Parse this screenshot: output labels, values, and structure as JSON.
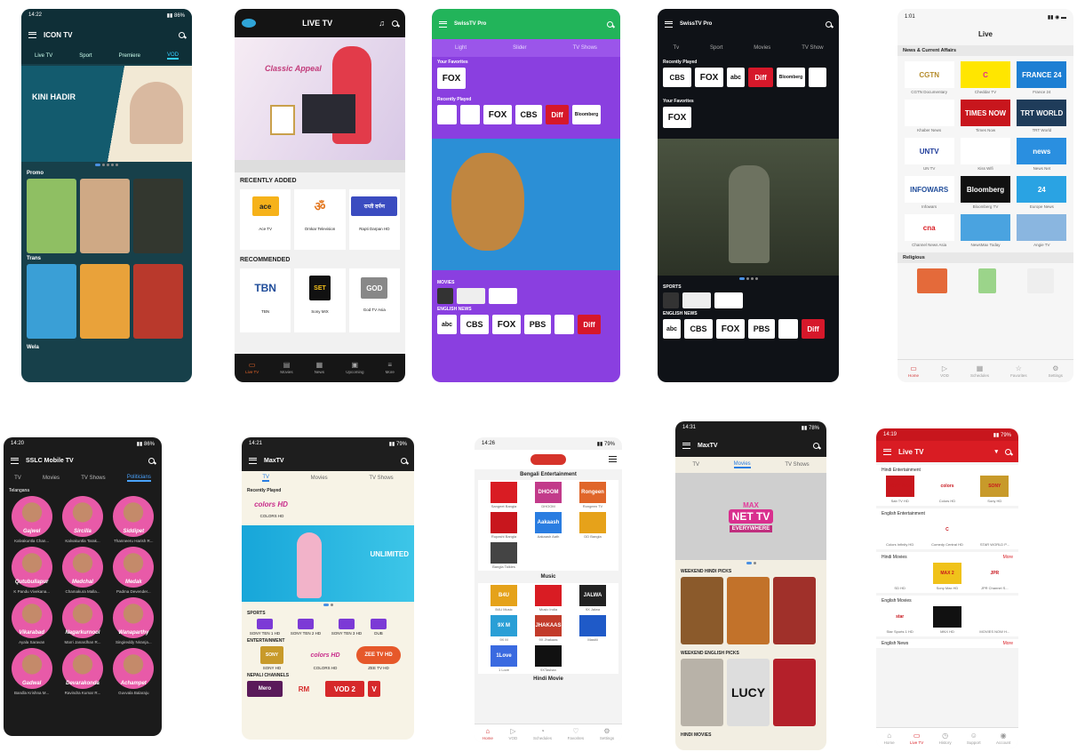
{
  "p1": {
    "time": "14:22",
    "title": "ICON TV",
    "tabs": [
      "Live TV",
      "Sport",
      "Premiere",
      "VOD"
    ],
    "banner": "KINI HADIR",
    "sec1": "Promo",
    "sec2": "Trans",
    "sec3": "Wela"
  },
  "p2": {
    "title": "LIVE TV",
    "banner_text": "Classic Appeal",
    "recent_title": "RECENTLY ADDED",
    "recent": [
      {
        "logo": "ace",
        "name": "Ace TV"
      },
      {
        "logo": "ॐ",
        "name": "Omkar Television"
      },
      {
        "logo": "राप्ती दर्पण",
        "name": "Rapti Darpan HD"
      }
    ],
    "rec_title": "RECOMMENDED",
    "rec": [
      {
        "logo": "TBN",
        "name": "TBN"
      },
      {
        "logo": "SET",
        "name": "Sony MIX"
      },
      {
        "logo": "GOD",
        "name": "God TV Asia"
      }
    ],
    "nav": [
      "Live TV",
      "Movies",
      "News",
      "Upcoming",
      "More"
    ]
  },
  "p3": {
    "title": "SwissTV Pro",
    "tabs": [
      "Light",
      "Slider",
      "TV Shows"
    ],
    "sec1": "Your Favorites",
    "fav": "FOX",
    "sec2": "Recently Played",
    "recent": [
      "",
      "",
      "FOX",
      "CBS",
      "Diff",
      "Bloomberg"
    ],
    "sec3": "MOVIES",
    "sec4": "ENGLISH NEWS",
    "news": [
      "abc",
      "CBS",
      "FOX",
      "PBS",
      "",
      "Diff"
    ]
  },
  "p4": {
    "title": "SwissTV Pro",
    "tabs": [
      "Tv",
      "Sport",
      "Movies",
      "TV Show"
    ],
    "sec1": "Recently Played",
    "recent": [
      "CBS",
      "FOX",
      "abc",
      "Diff",
      "Bloomberg",
      ""
    ],
    "sec2": "Your Favorites",
    "fav": "FOX",
    "sec3": "SPORTS",
    "sec4": "ENGLISH NEWS",
    "news": [
      "abc",
      "CBS",
      "FOX",
      "PBS",
      "",
      "Diff"
    ]
  },
  "p5": {
    "time": "1:01",
    "title": "Live",
    "sec1": "News & Current Affairs",
    "grid": [
      {
        "logo": "CGTN",
        "name": "CGTN Documentary"
      },
      {
        "logo": "C",
        "name": "Cheddar TV"
      },
      {
        "logo": "FRANCE 24",
        "name": "France 24"
      },
      {
        "logo": "",
        "name": "Khaber News"
      },
      {
        "logo": "TIMES NOW",
        "name": "Times Now"
      },
      {
        "logo": "TRT WORLD",
        "name": "TRT World"
      },
      {
        "logo": "UNTV",
        "name": "UN TV"
      },
      {
        "logo": "",
        "name": "Kiss Wifi"
      },
      {
        "logo": "news",
        "name": "News Net"
      },
      {
        "logo": "INFOWARS",
        "name": "Infowars"
      },
      {
        "logo": "Bloomberg",
        "name": "Bloomberg TV"
      },
      {
        "logo": "24",
        "name": "Europe News"
      },
      {
        "logo": "cna",
        "name": "Channel News Asia"
      },
      {
        "logo": "",
        "name": "NewsMax Today"
      },
      {
        "logo": "",
        "name": "Angie TV"
      }
    ],
    "sec2": "Religious",
    "nav": [
      "Home",
      "VOD",
      "Schedules",
      "Favorites",
      "Settings"
    ]
  },
  "p6": {
    "time": "14:20",
    "title": "SSLC Mobile TV",
    "tabs": [
      "TV",
      "Movies",
      "TV Shows",
      "Politicians"
    ],
    "sec": "Telangana",
    "people": [
      {
        "tag": "Gajwel",
        "name": "Kalvakuntla Chan..."
      },
      {
        "tag": "Sircilla",
        "name": "Kalvakuntla Tarak..."
      },
      {
        "tag": "Siddipet",
        "name": "Thanneeru Harish R..."
      },
      {
        "tag": "Qutubullapur",
        "name": "K Pandu Vivekana..."
      },
      {
        "tag": "Medchal",
        "name": "Chamakura Malla..."
      },
      {
        "tag": "Medak",
        "name": "Padma Devender..."
      },
      {
        "tag": "Vikarabad",
        "name": "Ayala Saravan"
      },
      {
        "tag": "Nagarkurnool",
        "name": "Marri Janardhan R..."
      },
      {
        "tag": "Wanaparthy",
        "name": "Singireddy Niranja..."
      },
      {
        "tag": "Gadwal",
        "name": "Bandla Krishna M..."
      },
      {
        "tag": "Devarakonda",
        "name": "Ravindra Kumar R..."
      },
      {
        "tag": "Achampet",
        "name": "Guvvala Balaraju"
      }
    ]
  },
  "p7": {
    "time": "14:21",
    "title": "MaxTV",
    "tabs": [
      "TV",
      "Movies",
      "TV Shows"
    ],
    "sec1": "Recently Played",
    "recent": {
      "logo": "colors HD",
      "name": "COLORS HD"
    },
    "banner": "UNLIMITED",
    "sec2": "SPORTS",
    "sports": [
      "SONY TEN 1 HD",
      "SONY TEN 2 HD",
      "SONY TEN 3 HD",
      "DUB"
    ],
    "sec3": "ENTERTAINMENT",
    "ent": [
      {
        "logo": "SONY",
        "name": "SONY HD"
      },
      {
        "logo": "colors HD",
        "name": "COLORS HD"
      },
      {
        "logo": "ZEE TV HD",
        "name": "ZEE TV HD"
      }
    ],
    "sec4": "NEPALI CHANNELS",
    "nepali": [
      "Mero",
      "RM",
      "VOD 2",
      "V"
    ]
  },
  "p8": {
    "time": "14:26",
    "sec1": "Bengali Entertainment",
    "beng": [
      {
        "logo": "",
        "name": "Sangeet Bangla"
      },
      {
        "logo": "DHOOM",
        "name": "DHOOM"
      },
      {
        "logo": "Rongeen",
        "name": "Rongeen TV"
      },
      {
        "logo": "",
        "name": "Rupashi Bangla"
      },
      {
        "logo": "Aakaash",
        "name": "Aakaash Aath"
      },
      {
        "logo": "",
        "name": "DD Bangla"
      },
      {
        "logo": "",
        "name": "Bangla Talkies"
      }
    ],
    "sec2": "Music",
    "music": [
      {
        "logo": "B4U",
        "name": "B4U Music"
      },
      {
        "logo": "",
        "name": "Music India"
      },
      {
        "logo": "JALWA",
        "name": "9X Jalwa"
      },
      {
        "logo": "9X M",
        "name": "9X M"
      },
      {
        "logo": "JHAKAAS",
        "name": "9X Jhakaas"
      },
      {
        "logo": "",
        "name": "Mastiii"
      },
      {
        "logo": "1Love",
        "name": "1 Love"
      },
      {
        "logo": "",
        "name": "9XTashan"
      }
    ],
    "sec3": "Hindi Movie",
    "nav": [
      "Home",
      "VOD",
      "Schedules",
      "Favorites",
      "Settings"
    ]
  },
  "p9": {
    "time": "14:31",
    "title": "MaxTV",
    "tabs": [
      "TV",
      "Movies",
      "TV Shows"
    ],
    "banner1": "MAX",
    "banner2": "NET TV",
    "banner3": "EVERYWHERE",
    "sec1": "WEEKEND HINDI PICKS",
    "sec2": "WEEKEND ENGLISH PICKS",
    "lucy": "LUCY",
    "sec3": "HINDI MOVIES"
  },
  "p10": {
    "time": "14:19",
    "title": "Live TV",
    "sec1": "Hindi Entertainment",
    "hindi": [
      {
        "logo": "SONY SAB",
        "name": "Sab TV HD"
      },
      {
        "logo": "colors",
        "name": "Colors HD"
      },
      {
        "logo": "SONY",
        "name": "Sony HD"
      }
    ],
    "sec2": "English Entertainment",
    "eng": [
      {
        "logo": "",
        "name": "Colors Infinity HD"
      },
      {
        "logo": "C",
        "name": "Comedy Central HD"
      },
      {
        "logo": "",
        "name": "STAR WORLD P..."
      }
    ],
    "sec3": "Hindi Movies",
    "more": "More",
    "movies": [
      {
        "logo": "",
        "name": "SD HD"
      },
      {
        "logo": "MAX 2",
        "name": "Sony Max HD"
      },
      {
        "logo": "JPR",
        "name": "JPR Channel S..."
      }
    ],
    "sec4": "English Movies",
    "emov": [
      {
        "logo": "star",
        "name": "Star Sports 1 HD"
      },
      {
        "logo": "",
        "name": "MNX HD"
      },
      {
        "logo": "",
        "name": "MOVIES NOW H..."
      }
    ],
    "sec5": "English News",
    "nav": [
      "Home",
      "Live TV",
      "History",
      "Support",
      "Account"
    ]
  }
}
